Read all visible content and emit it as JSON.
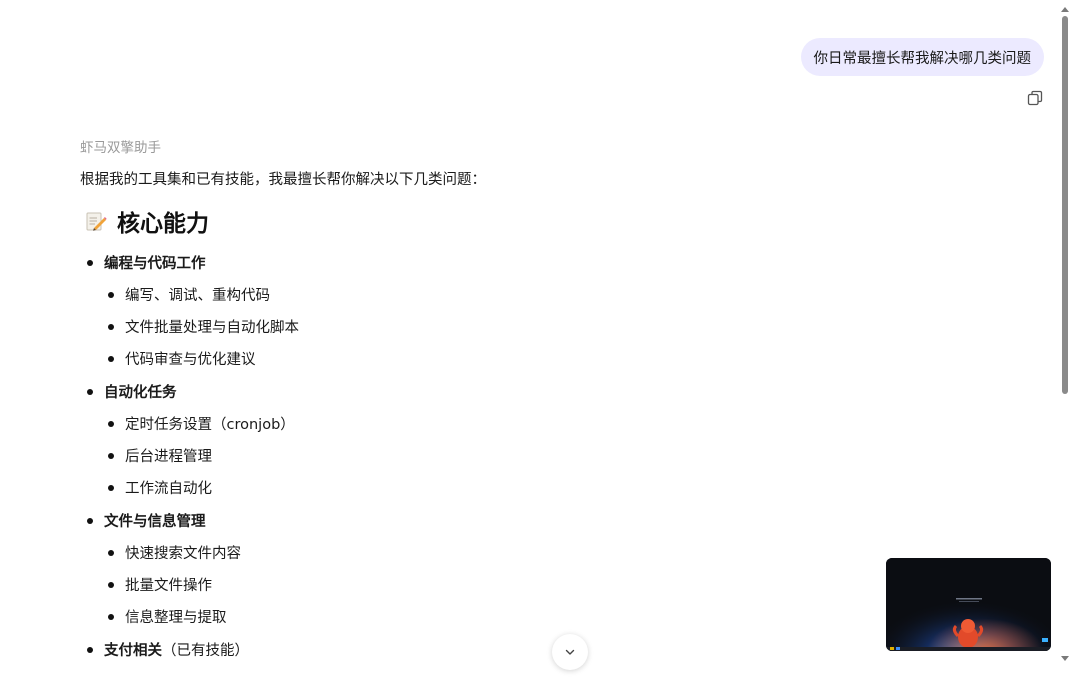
{
  "user_message": "你日常最擅长帮我解决哪几类问题",
  "assistant": {
    "name": "虾马双擎助手",
    "intro": "根据我的工具集和已有技能，我最擅长帮你解决以下几类问题：",
    "heading": "核心能力",
    "sections": [
      {
        "title": "编程与代码工作",
        "suffix": "",
        "items": [
          "编写、调试、重构代码",
          "文件批量处理与自动化脚本",
          "代码审查与优化建议"
        ]
      },
      {
        "title": "自动化任务",
        "suffix": "",
        "items": [
          "定时任务设置（cronjob）",
          "后台进程管理",
          "工作流自动化"
        ]
      },
      {
        "title": "文件与信息管理",
        "suffix": "",
        "items": [
          "快速搜索文件内容",
          "批量文件操作",
          "信息整理与提取"
        ]
      },
      {
        "title": "支付相关",
        "suffix": "（已有技能）",
        "items": []
      }
    ]
  },
  "icons": {
    "copy": "copy-icon",
    "heading_emoji": "memo-icon",
    "scroll_down": "chevron-down-icon"
  },
  "colors": {
    "user_bubble_bg": "#eceaff",
    "muted_text": "#9a9a9a"
  }
}
